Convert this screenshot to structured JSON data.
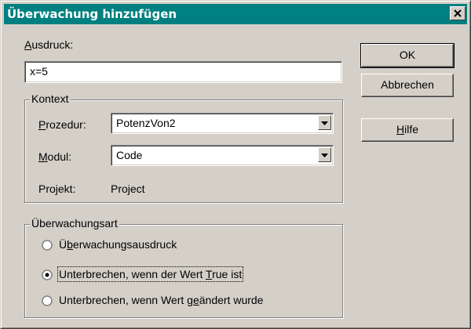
{
  "window": {
    "title": "Überwachung hinzufügen",
    "close_icon": "close-icon"
  },
  "expression": {
    "label_ul": "A",
    "label_rest": "usdruck:",
    "value": "x=5"
  },
  "context": {
    "title": "Kontext",
    "procedure": {
      "label_ul": "P",
      "label_rest": "rozedur:",
      "value": "PotenzVon2"
    },
    "module": {
      "label_ul": "M",
      "label_rest": "odul:",
      "value": "Code"
    },
    "project": {
      "label": "Projekt:",
      "value": "Project"
    }
  },
  "watch_type": {
    "title": "Überwachungsart",
    "options": [
      {
        "pre": "Ü",
        "ul": "b",
        "post": "erwachungsausdruck",
        "selected": false
      },
      {
        "pre": "Unterbrechen, wenn der Wert ",
        "ul": "T",
        "post": "rue ist",
        "selected": true
      },
      {
        "pre": "Unterbrechen, wenn Wert g",
        "ul": "e",
        "post": "ändert wurde",
        "selected": false
      }
    ]
  },
  "buttons": {
    "ok": "OK",
    "cancel": "Abbrechen",
    "help_ul": "H",
    "help_rest": "ilfe"
  },
  "colors": {
    "titlebar": "#008080",
    "face": "#d4d0c8"
  }
}
